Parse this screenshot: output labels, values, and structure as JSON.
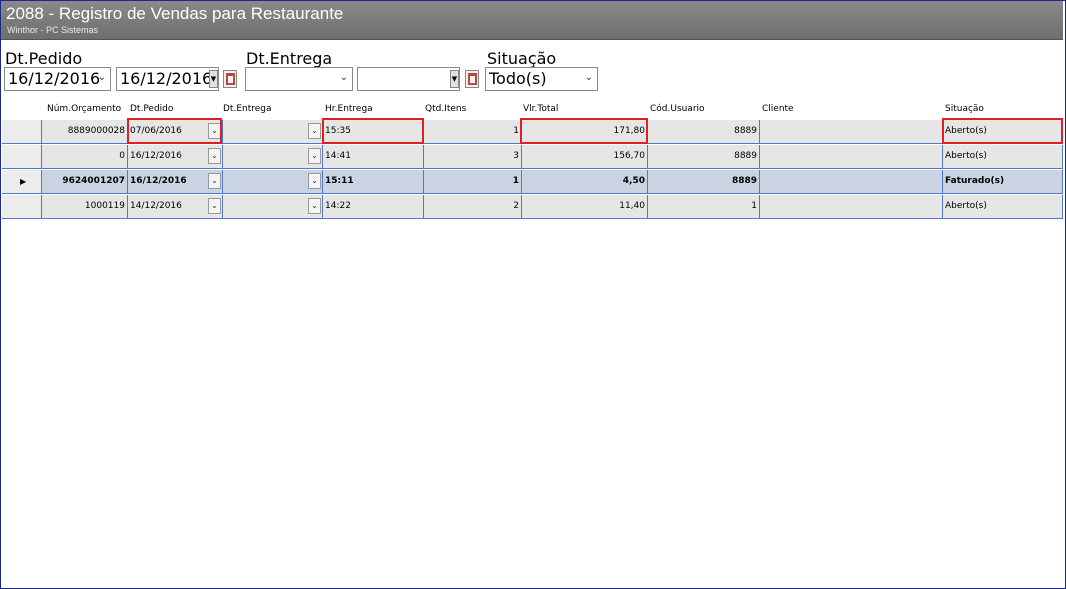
{
  "window": {
    "title": "2088 - Registro de Vendas para Restaurante",
    "subtitle": "Winthor - PC Sistemas"
  },
  "filters": {
    "dt_pedido_label": "Dt.Pedido",
    "dt_pedido_from": "16/12/2016",
    "dt_pedido_to": "16/12/2016",
    "dt_entrega_label": "Dt.Entrega",
    "dt_entrega_from": "",
    "dt_entrega_to": "",
    "situacao_label": "Situação",
    "situacao_value": "Todo(s)"
  },
  "table": {
    "headers": [
      "Núm.Orçamento",
      "Dt.Pedido",
      "Dt.Entrega",
      "Hr.Entrega",
      "Qtd.Itens",
      "Vlr.Total",
      "Cód.Usuario",
      "Cliente",
      "Situação"
    ],
    "rows": [
      {
        "num": "8889000028",
        "dt_pedido": "07/06/2016",
        "dt_entrega": "",
        "hr_entrega": "15:35",
        "qtd": "1",
        "vlr": "171,80",
        "usuario": "8889",
        "cliente": "",
        "situacao": "Aberto(s)",
        "selected": false
      },
      {
        "num": "0",
        "dt_pedido": "16/12/2016",
        "dt_entrega": "",
        "hr_entrega": "14:41",
        "qtd": "3",
        "vlr": "156,70",
        "usuario": "8889",
        "cliente": "",
        "situacao": "Aberto(s)",
        "selected": false
      },
      {
        "num": "9624001207",
        "dt_pedido": "16/12/2016",
        "dt_entrega": "",
        "hr_entrega": "15:11",
        "qtd": "1",
        "vlr": "4,50",
        "usuario": "8889",
        "cliente": "",
        "situacao": "Faturado(s)",
        "selected": true
      },
      {
        "num": "1000119",
        "dt_pedido": "14/12/2016",
        "dt_entrega": "",
        "hr_entrega": "14:22",
        "qtd": "2",
        "vlr": "11,40",
        "usuario": "1",
        "cliente": "",
        "situacao": "Aberto(s)",
        "selected": false
      }
    ]
  },
  "colors": {
    "highlight": "#e02020",
    "grid_line": "#4f78c8",
    "selected_row": "#c9d3e2"
  }
}
